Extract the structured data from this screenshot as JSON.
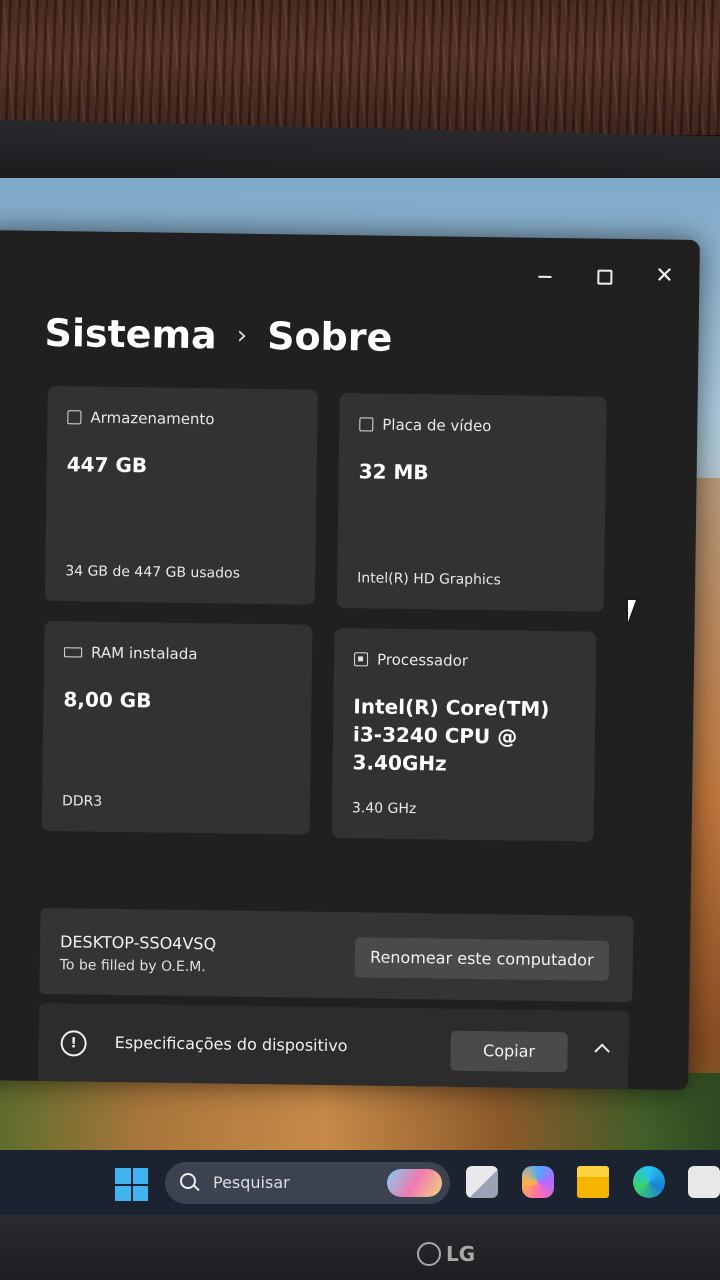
{
  "breadcrumb": {
    "parent": "Sistema",
    "separator": "›",
    "current": "Sobre"
  },
  "window_controls": {
    "close_glyph": "✕"
  },
  "cards": {
    "storage": {
      "title": "Armazenamento",
      "value": "447 GB",
      "detail": "34 GB de 447 GB usados",
      "icon": "storage-drive-icon"
    },
    "gpu": {
      "title": "Placa de vídeo",
      "value": "32 MB",
      "detail": "Intel(R) HD Graphics",
      "icon": "display-card-icon"
    },
    "ram": {
      "title": "RAM instalada",
      "value": "8,00 GB",
      "detail": "DDR3",
      "icon": "memory-module-icon"
    },
    "cpu": {
      "title": "Processador",
      "value": "Intel(R) Core(TM) i3-3240 CPU @ 3.40GHz",
      "detail": "3.40 GHz",
      "icon": "processor-chip-icon"
    }
  },
  "device": {
    "name": "DESKTOP-SSO4VSQ",
    "subtitle": "To be filled by O.E.M.",
    "rename_label": "Renomear este computador"
  },
  "specs": {
    "label": "Especificações do dispositivo",
    "info_glyph": "!",
    "copy_label": "Copiar"
  },
  "taskbar": {
    "search_placeholder": "Pesquisar"
  },
  "monitor": {
    "brand": "LG"
  },
  "colors": {
    "window_bg": "#202020",
    "card_bg": "#333231",
    "taskbar_bg": "#1b2230",
    "start_accent": "#3fb4f0"
  }
}
